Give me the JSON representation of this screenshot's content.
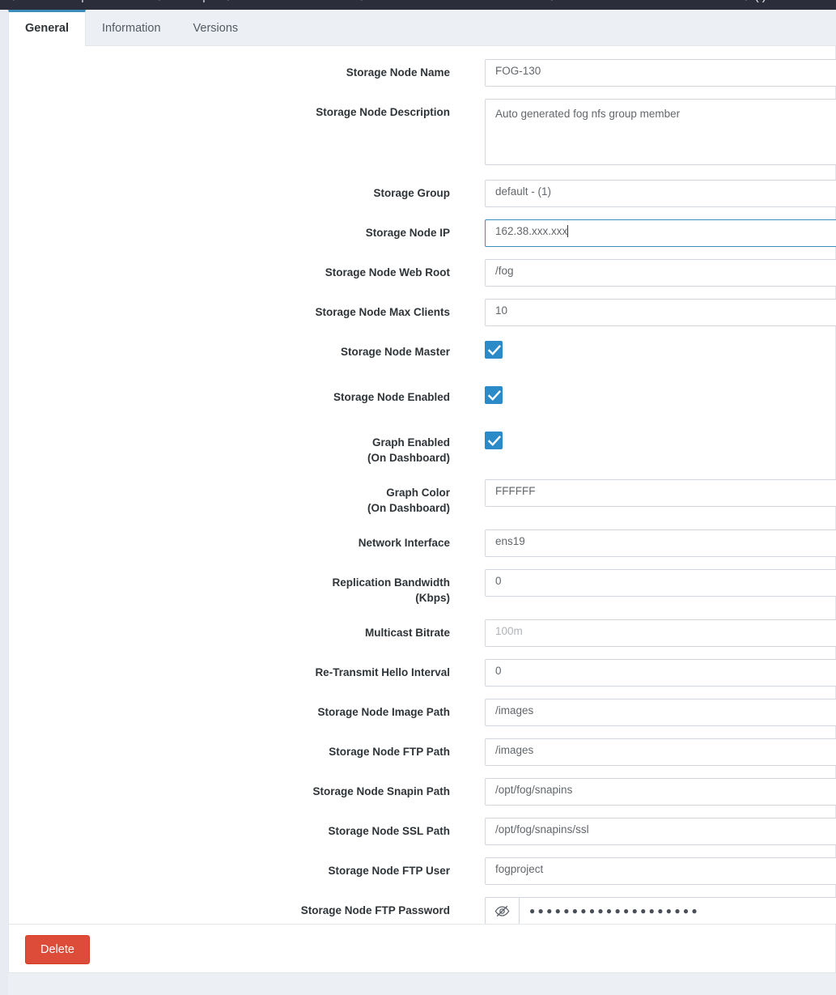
{
  "navbar": {
    "background": "#2b2d3a",
    "glyphs": [
      "⚙",
      "|",
      "⚙",
      "|",
      "⚙",
      "⚙",
      "⚙",
      "⚙ ( )",
      "⤵",
      "⚙",
      "⚙ ⤵"
    ]
  },
  "tabs": [
    {
      "label": "General",
      "active": true
    },
    {
      "label": "Information",
      "active": false
    },
    {
      "label": "Versions",
      "active": false
    }
  ],
  "colors": {
    "accent": "#3c8dbc",
    "checkbox": "#2a8bc8",
    "danger": "#dd4b39",
    "page_background": "#ecf0f5",
    "border": "#d2d6de"
  },
  "form": {
    "fields": [
      {
        "label": "Storage Node Name",
        "label2": "",
        "type": "text",
        "value": "FOG-130",
        "name": "storage-node-name"
      },
      {
        "label": "Storage Node Description",
        "label2": "",
        "type": "textarea",
        "value": "Auto generated fog nfs group member",
        "name": "storage-node-description"
      },
      {
        "label": "Storage Group",
        "label2": "",
        "type": "text",
        "value": "default - (1)",
        "name": "storage-group"
      },
      {
        "label": "Storage Node IP",
        "label2": "",
        "type": "text",
        "value": "162.38.xxx.xxx",
        "focused": true,
        "name": "storage-node-ip"
      },
      {
        "label": "Storage Node Web Root",
        "label2": "",
        "type": "text",
        "value": "/fog",
        "name": "storage-node-web-root"
      },
      {
        "label": "Storage Node Max Clients",
        "label2": "",
        "type": "text",
        "value": "10",
        "name": "storage-node-max-clients"
      },
      {
        "label": "Storage Node Master",
        "label2": "",
        "type": "checkbox",
        "checked": true,
        "name": "storage-node-master"
      },
      {
        "label": "Storage Node Enabled",
        "label2": "",
        "type": "checkbox",
        "checked": true,
        "name": "storage-node-enabled"
      },
      {
        "label": "Graph Enabled",
        "label2": "(On Dashboard)",
        "type": "checkbox",
        "checked": true,
        "name": "graph-enabled"
      },
      {
        "label": "Graph Color",
        "label2": "(On Dashboard)",
        "type": "text",
        "value": "FFFFFF",
        "name": "graph-color"
      },
      {
        "label": "Network Interface",
        "label2": "",
        "type": "text",
        "value": "ens19",
        "name": "network-interface"
      },
      {
        "label": "Replication Bandwidth",
        "label2": "(Kbps)",
        "type": "text",
        "value": "0",
        "name": "replication-bandwidth"
      },
      {
        "label": "Multicast Bitrate",
        "label2": "",
        "type": "text",
        "value": "",
        "placeholder": "100m",
        "name": "multicast-bitrate"
      },
      {
        "label": "Re-Transmit Hello Interval",
        "label2": "",
        "type": "text",
        "value": "0",
        "name": "re-transmit-hello-interval"
      },
      {
        "label": "Storage Node Image Path",
        "label2": "",
        "type": "text",
        "value": "/images",
        "name": "storage-node-image-path"
      },
      {
        "label": "Storage Node FTP Path",
        "label2": "",
        "type": "text",
        "value": "/images",
        "name": "storage-node-ftp-path"
      },
      {
        "label": "Storage Node Snapin Path",
        "label2": "",
        "type": "text",
        "value": "/opt/fog/snapins",
        "name": "storage-node-snapin-path"
      },
      {
        "label": "Storage Node SSL Path",
        "label2": "",
        "type": "text",
        "value": "/opt/fog/snapins/ssl",
        "name": "storage-node-ssl-path"
      },
      {
        "label": "Storage Node FTP User",
        "label2": "",
        "type": "text",
        "value": "fogproject",
        "name": "storage-node-ftp-user"
      },
      {
        "label": "Storage Node FTP Password",
        "label2": "",
        "type": "password",
        "value": "●●●●●●●●●●●●●●●●●●●●",
        "addon_icon": "eye-slash-icon",
        "name": "storage-node-ftp-password"
      }
    ]
  },
  "footer": {
    "delete_label": "Delete"
  }
}
